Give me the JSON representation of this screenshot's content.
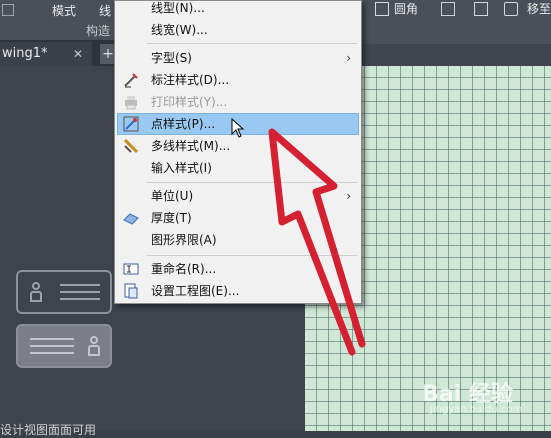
{
  "ribbon": {
    "mode_label": "模式",
    "line_label": "线",
    "construct_label": "构造",
    "fillet_label": "圆角",
    "move_label": "移至"
  },
  "tabs": {
    "file_tab": "wing1*",
    "close": "✕",
    "add": "+"
  },
  "menu": {
    "items": [
      {
        "label": "线型(N)...",
        "icon": null,
        "disabled": false,
        "submenu": false
      },
      {
        "label": "线宽(W)...",
        "icon": null,
        "disabled": false,
        "submenu": false
      },
      {
        "label": "字型(S)",
        "icon": null,
        "disabled": false,
        "submenu": true
      },
      {
        "label": "标注样式(D)...",
        "icon": "dimension-style-icon",
        "disabled": false,
        "submenu": false
      },
      {
        "label": "打印样式(Y)...",
        "icon": "plot-style-icon",
        "disabled": true,
        "submenu": false
      },
      {
        "label": "点样式(P)...",
        "icon": "point-style-icon",
        "disabled": false,
        "submenu": false,
        "highlighted": true
      },
      {
        "label": "多线样式(M)...",
        "icon": "multiline-style-icon",
        "disabled": false,
        "submenu": false
      },
      {
        "label": "输入样式(I)",
        "icon": null,
        "disabled": false,
        "submenu": false
      },
      {
        "label": "单位(U)",
        "icon": null,
        "disabled": false,
        "submenu": true
      },
      {
        "label": "厚度(T)",
        "icon": "thickness-icon",
        "disabled": false,
        "submenu": false
      },
      {
        "label": "图形界限(A)",
        "icon": null,
        "disabled": false,
        "submenu": false
      },
      {
        "label": "重命名(R)...",
        "icon": "rename-icon",
        "disabled": false,
        "submenu": false
      },
      {
        "label": "设置工程图(E)...",
        "icon": "setup-drawing-icon",
        "disabled": false,
        "submenu": false
      }
    ],
    "submenu_arrow": "›"
  },
  "bottom_text": "设计视图面面可用",
  "watermark": {
    "text": "Bai 经验",
    "sub": "jingyan.baidu.com"
  },
  "colors": {
    "menu_highlight": "#99c9f2",
    "annotation_red": "#d42030",
    "drawing_bg": "#cfe8d6"
  }
}
